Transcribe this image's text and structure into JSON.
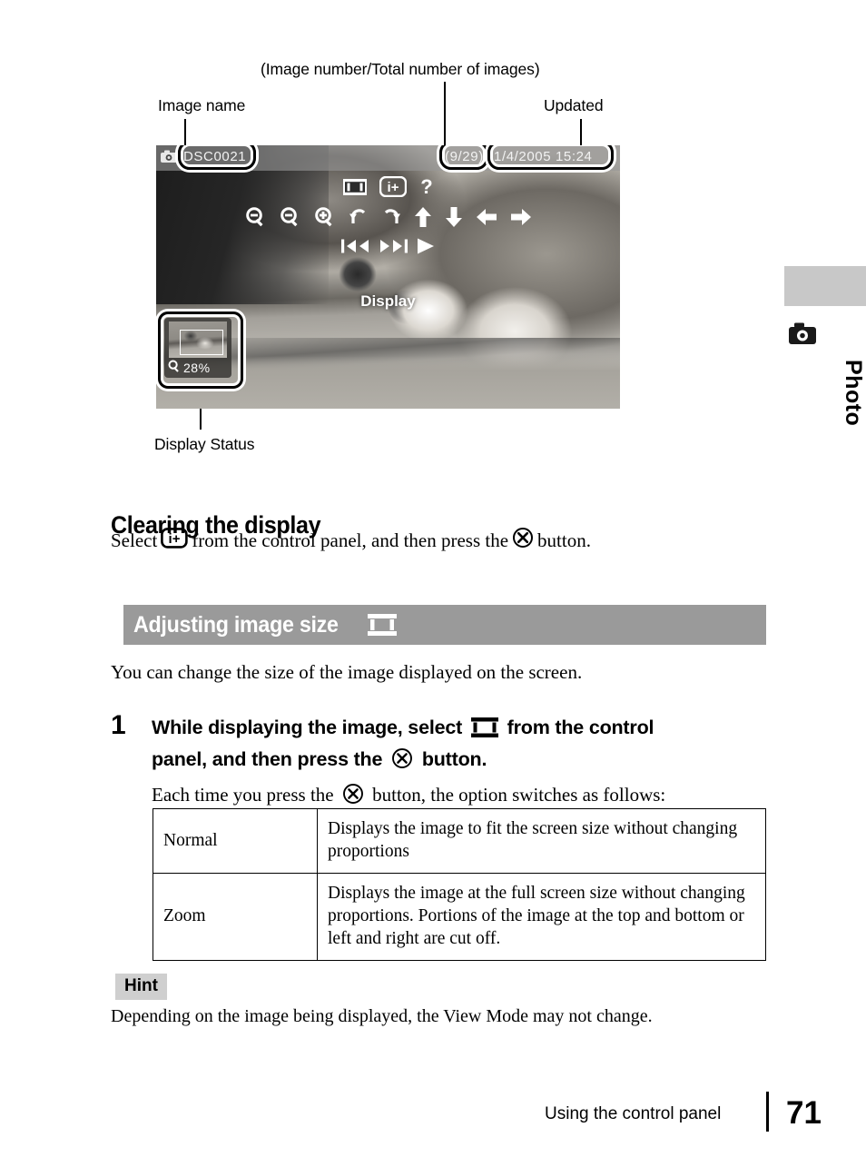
{
  "diagram": {
    "callouts": {
      "total": "(Image number/Total number of images)",
      "image_name": "Image name",
      "updated": "Updated",
      "display_status": "Display Status"
    },
    "screen": {
      "camera_badge_icon": "camera-icon",
      "image_name": "DSC0021",
      "image_count": "(9/29)",
      "updated_datetime": "1/4/2005 15:24",
      "control_panel_label": "Display",
      "control_panel_icons": [
        "image-size-icon",
        "info-display-icon",
        "help-question-icon",
        "zoom-reset-icon",
        "zoom-out-icon",
        "zoom-in-icon",
        "rotate-left-icon",
        "rotate-right-icon",
        "scroll-up-icon",
        "scroll-down-icon",
        "scroll-left-icon",
        "scroll-right-icon",
        "previous-image-icon",
        "next-image-icon",
        "slideshow-play-icon"
      ],
      "display_status": {
        "zoom_icon": "magnifier-icon",
        "zoom_level": "28%"
      }
    }
  },
  "side_tab": {
    "icon": "camera-icon",
    "label": "Photo"
  },
  "sections": {
    "clearing": {
      "heading": "Clearing the display",
      "body_before": "Select",
      "body_middle": "from the control panel, and then press the",
      "body_after": "button.",
      "info_icon": "info-display-icon",
      "cross_icon": "cross-button-icon"
    },
    "adjusting": {
      "band_title": "Adjusting image size",
      "band_icon": "image-size-icon",
      "intro": "You can change the size of the image displayed on the screen.",
      "step_number": "1",
      "step_text_a": "While displaying the image, select",
      "step_text_b": "from the control",
      "step_text_c": "panel, and then press the",
      "step_text_d": "button.",
      "step_sub_a": "Each time you press the",
      "step_sub_b": "button, the option switches as follows:"
    }
  },
  "table": {
    "rows": [
      {
        "name": "Normal",
        "description": "Displays the image to fit the screen size without changing proportions"
      },
      {
        "name": "Zoom",
        "description": "Displays the image at the full screen size without changing proportions. Portions of the image at the top and bottom or left and right are cut off."
      }
    ]
  },
  "hint": {
    "badge": "Hint",
    "text": "Depending on the image being displayed, the View Mode may not change."
  },
  "footer": {
    "running_head": "Using the control panel",
    "page_number": "71"
  },
  "colors": {
    "band_gray": "#9a9a9a",
    "tab_gray": "#c8c8c8",
    "hint_gray": "#cfcfcf",
    "text": "#000000"
  }
}
